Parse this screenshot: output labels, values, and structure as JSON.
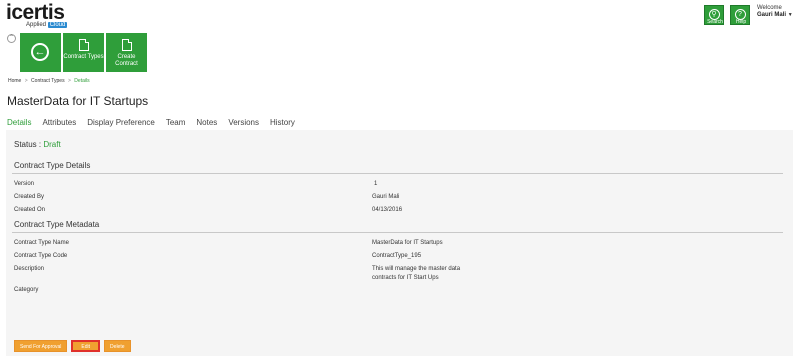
{
  "brand": {
    "logo_text": "icertis",
    "sub_text": "Applied",
    "sub_cloud": "Cloud"
  },
  "topbar": {
    "search_label": "Search",
    "help_label": "Help",
    "welcome_label": "Welcome",
    "user_name": "Gauri Mali",
    "user_caret": "▼"
  },
  "tiles": {
    "back_symbol": "←",
    "contract_types_label": "Contract Types",
    "create_contract_label": "Create Contract"
  },
  "breadcrumb": {
    "home": "Home",
    "contract_types": "Contract Types",
    "current": "Details",
    "separator": ">"
  },
  "page": {
    "title": "MasterData for IT Startups"
  },
  "tabs": [
    {
      "label": "Details"
    },
    {
      "label": "Attributes"
    },
    {
      "label": "Display Preference"
    },
    {
      "label": "Team"
    },
    {
      "label": "Notes"
    },
    {
      "label": "Versions"
    },
    {
      "label": "History"
    }
  ],
  "status": {
    "label": "Status : ",
    "value": "Draft"
  },
  "details_section": {
    "heading": "Contract Type Details",
    "rows": [
      {
        "label": "Version",
        "value": "1"
      },
      {
        "label": "Created By",
        "value": "Gauri Mali"
      },
      {
        "label": "Created On",
        "value": "04/13/2016"
      }
    ]
  },
  "metadata_section": {
    "heading": "Contract Type Metadata",
    "rows": [
      {
        "label": "Contract Type Name",
        "value": "MasterData for IT Startups"
      },
      {
        "label": "Contract Type Code",
        "value": "ContractType_195"
      },
      {
        "label": "Description",
        "value": "This will manage the master data contracts for IT Start Ups",
        "value_line1": "This will manage the master data",
        "value_line2": "contracts for IT Start Ups"
      },
      {
        "label": "Category",
        "value": ""
      }
    ]
  },
  "actions": {
    "send_for_approval": "Send For Approval",
    "edit": "Edit",
    "delete": "Delete"
  },
  "colors": {
    "accent_green": "#2f9e3a",
    "action_orange": "#f0a030",
    "highlight_red": "#e0302a"
  },
  "icons": [
    "search-icon",
    "help-icon",
    "collapse-icon",
    "back-arrow-icon",
    "contract-types-icon",
    "create-contract-icon"
  ]
}
